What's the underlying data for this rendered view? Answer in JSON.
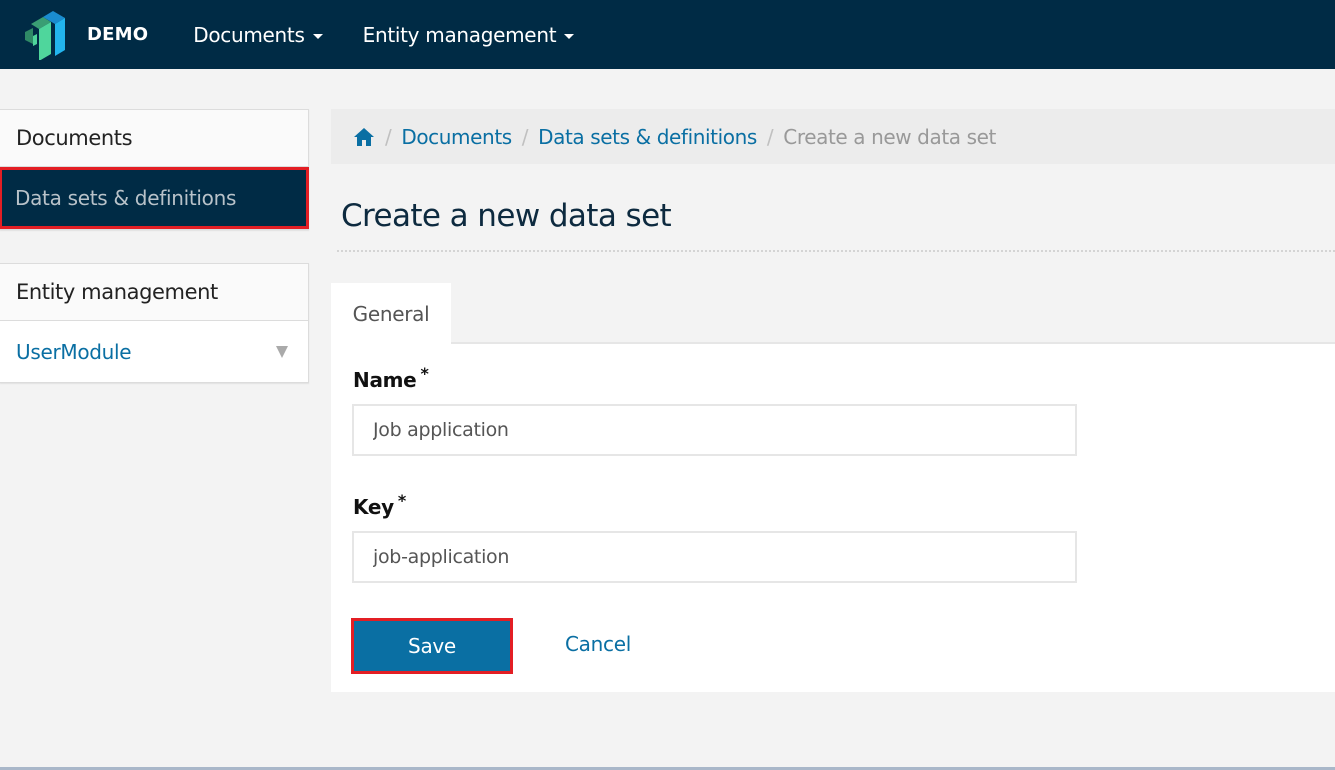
{
  "navbar": {
    "brand": "DEMO",
    "menus": [
      {
        "label": "Documents"
      },
      {
        "label": "Entity management"
      }
    ],
    "colors": {
      "background": "#002b45",
      "logo_green": "#4fd69c",
      "logo_blue": "#22b5ee"
    }
  },
  "sidebar": {
    "panels": [
      {
        "heading": "Documents",
        "items": [
          {
            "label": "Data sets & definitions",
            "active": true
          }
        ]
      },
      {
        "heading": "Entity management",
        "items": [
          {
            "label": "UserModule",
            "icon": "triangle-down-icon"
          }
        ]
      }
    ]
  },
  "breadcrumb": {
    "home_icon": "home-icon",
    "items": [
      {
        "label": "Documents"
      },
      {
        "label": "Data sets & definitions"
      },
      {
        "label": "Create a new data set",
        "current": true
      }
    ]
  },
  "page": {
    "title": "Create a new data set",
    "tabs": [
      {
        "label": "General",
        "active": true
      }
    ]
  },
  "form": {
    "fields": [
      {
        "label": "Name",
        "required_mark": "*",
        "value": "Job application"
      },
      {
        "label": "Key",
        "required_mark": "*",
        "value": "job-application"
      }
    ],
    "save_label": "Save",
    "cancel_label": "Cancel"
  },
  "colors": {
    "accent": "#0a6fa3",
    "highlight_border": "#e31e24"
  }
}
